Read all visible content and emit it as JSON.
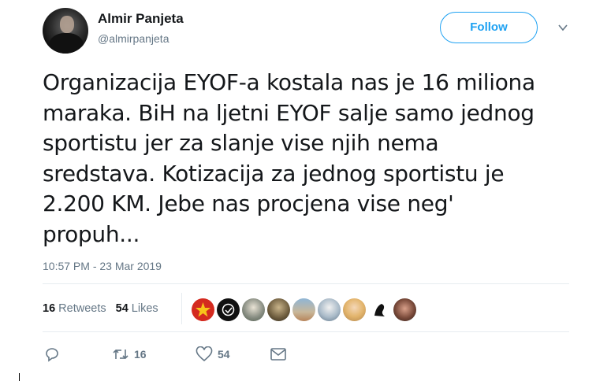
{
  "author": {
    "name": "Almir Panjeta",
    "handle": "@almirpanjeta"
  },
  "follow_button": {
    "label": "Follow"
  },
  "tweet": {
    "text": "Organizacija EYOF-a kostala nas je 16 miliona\nmaraka. BiH na ljetni EYOF salje samo jednog\nsportistu jer za slanje vise njih nema\nsredstava. Kotizacija za jednog sportistu je\n2.200 KM. Jebe nas procjena vise neg'\npropuh...",
    "timestamp": "10:57 PM - 23 Mar 2019"
  },
  "stats": {
    "retweets_count": "16",
    "retweets_label": "Retweets",
    "likes_count": "54",
    "likes_label": "Likes"
  },
  "actions": {
    "retweet_count": "16",
    "like_count": "54"
  },
  "icons": {
    "reply": "reply-icon",
    "retweet": "retweet-icon",
    "like": "heart-icon",
    "message": "envelope-icon",
    "menu": "chevron-down-icon"
  },
  "colors": {
    "accent": "#1da1f2",
    "secondary_text": "#657786",
    "primary_text": "#14171a"
  }
}
